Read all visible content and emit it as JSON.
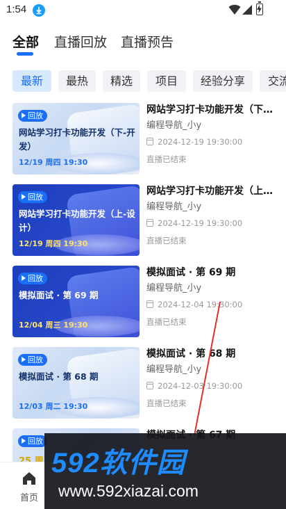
{
  "status": {
    "time": "1:54"
  },
  "main_tabs": [
    {
      "label": "全部",
      "active": true
    },
    {
      "label": "直播回放",
      "active": false
    },
    {
      "label": "直播预告",
      "active": false
    }
  ],
  "chips": [
    {
      "label": "最新",
      "active": true
    },
    {
      "label": "最热",
      "active": false
    },
    {
      "label": "精选",
      "active": false
    },
    {
      "label": "项目",
      "active": false
    },
    {
      "label": "经验分享",
      "active": false
    },
    {
      "label": "交流",
      "active": false
    }
  ],
  "items": [
    {
      "badge": "回放",
      "thumb_title": "网站学习打卡功能开发（下-开发）",
      "thumb_date": "12/19 周四 19:30",
      "title": "网站学习打卡功能开发（下…",
      "author": "编程导航_小y",
      "time": "2024-12-19 19:30:00",
      "status": "直播已结束",
      "theme": "light"
    },
    {
      "badge": "回放",
      "thumb_title": "网站学习打卡功能开发（上-设计）",
      "thumb_date": "12/19 周四 19:30",
      "title": "网站学习打卡功能开发（上…",
      "author": "编程导航_小y",
      "time": "2024-12-19 19:30:00",
      "status": "直播已结束",
      "theme": "dark"
    },
    {
      "badge": "回放",
      "thumb_title": "模拟面试 · 第 69 期",
      "thumb_date": "12/04 周三 19:30",
      "title": "模拟面试 · 第 69 期",
      "author": "编程导航_小y",
      "time": "2024-12-04 19:30:00",
      "status": "直播已结束",
      "theme": "dark"
    },
    {
      "badge": "回放",
      "thumb_title": "模拟面试 · 第 68 期",
      "thumb_date": "12/03 周二 19:30",
      "title": "模拟面试 · 第 68 期",
      "author": "编程导航_小y",
      "time": "2024-12-03 19:30:00",
      "status": "直播已结束",
      "theme": "light"
    },
    {
      "badge": "回放",
      "thumb_title": "",
      "thumb_date": "25 周",
      "title": "模拟面试 · 第 67 期",
      "author": "",
      "time": "",
      "status": "",
      "theme": "light"
    }
  ],
  "bottom_nav": {
    "home_label": "首页",
    "home_icon": "home-icon"
  },
  "watermark": {
    "brand": "592软件园",
    "url": "www.592xiazai.com"
  },
  "colors": {
    "accent": "#1b6ef7",
    "chip_active_bg": "#d8e8fd",
    "chip_bg": "#f1f2f5"
  }
}
